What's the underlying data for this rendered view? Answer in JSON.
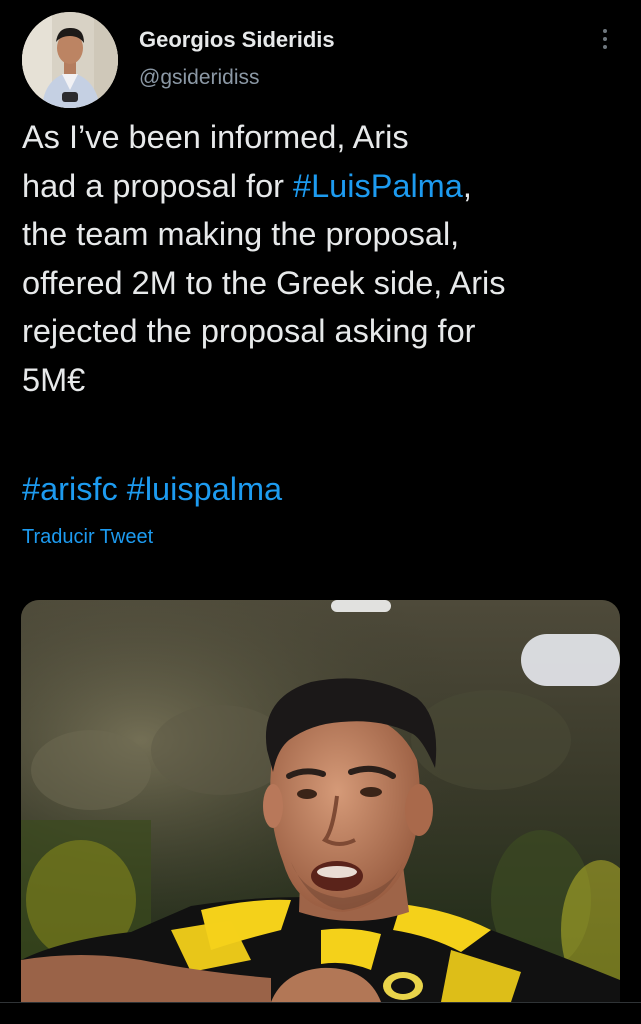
{
  "author": {
    "name": "Georgios Sideridis",
    "handle": "@gsideridiss"
  },
  "tweet": {
    "lines": [
      {
        "text": "As I’ve been informed, Aris"
      },
      {
        "pre": "had a proposal for ",
        "hashtag": "#LuisPalma",
        "post": ","
      },
      {
        "text": "the team making the proposal,"
      },
      {
        "text": "offered 2M to the Greek side, Aris"
      },
      {
        "text": "rejected the proposal asking for"
      },
      {
        "text": "5M€"
      }
    ],
    "hashtags": [
      "#arisfc",
      "#luispalma"
    ],
    "translate_label": "Traducir Tweet"
  },
  "icons": {
    "more": "more-vertical-icon"
  },
  "colors": {
    "background": "#000000",
    "text": "#e7e9ea",
    "secondary_text": "#8b98a5",
    "link": "#1d9bf0",
    "kit_yellow": "#f4d11a",
    "kit_black": "#111111"
  }
}
